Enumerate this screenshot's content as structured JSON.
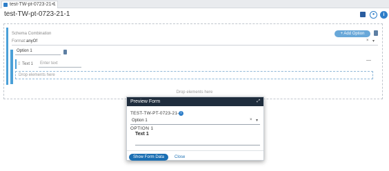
{
  "tab": {
    "label": "test-TW-pt-0723-21-1",
    "close": "×"
  },
  "header": {
    "title": "test-TW-pt-0723-21-1"
  },
  "schema": {
    "label": "Schema Combination",
    "format_label": "Format:",
    "format_value": "anyOf",
    "add_option_label": "+ Add Option"
  },
  "option": {
    "value": "Option 1",
    "text_label": "Text 1",
    "text_placeholder": "Enter text",
    "inner_drop": "Drop elements here",
    "outer_drop": "Drop elements here"
  },
  "preview": {
    "header": "Preview Form",
    "form_title": "TEST-TW-PT-0723-21-1",
    "select_value": "Option 1",
    "option_heading": "OPTION 1",
    "text_heading": "Text 1",
    "show_button": "Show Form Data",
    "close_button": "Close"
  },
  "colors": {
    "accent": "#2f7fc9",
    "modal_header": "#1f2d3d",
    "bar": "#4aa0d8"
  }
}
